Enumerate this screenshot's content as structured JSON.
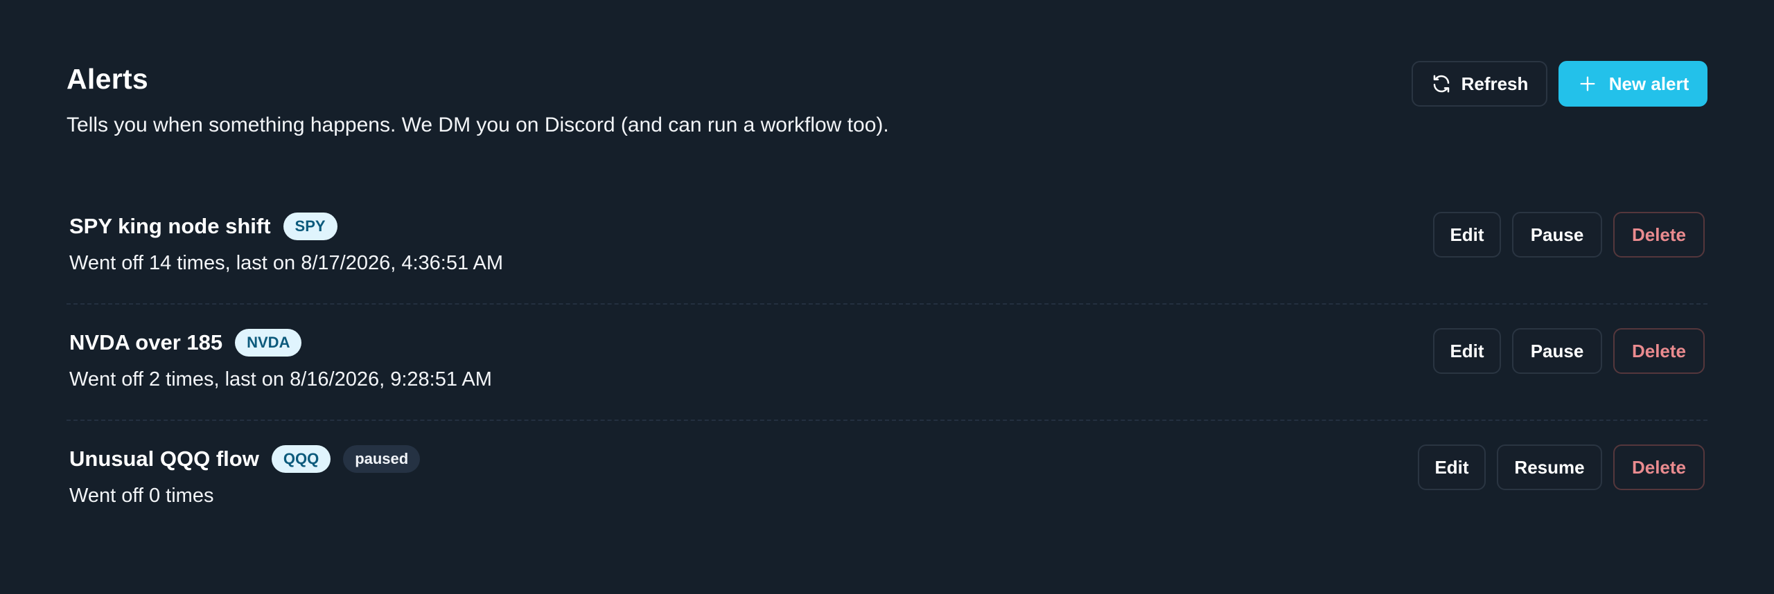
{
  "header": {
    "title": "Alerts",
    "subtitle": "Tells you when something happens. We DM you on Discord (and can run a workflow too).",
    "refresh_label": "Refresh",
    "new_alert_label": "New alert",
    "refresh_icon": "refresh-icon",
    "plus_icon": "plus-icon"
  },
  "alerts": [
    {
      "name": "SPY king node shift",
      "ticker": "SPY",
      "status": "",
      "meta": "Went off 14 times, last on 8/17/2026, 4:36:51 AM",
      "edit_label": "Edit",
      "toggle_label": "Pause",
      "delete_label": "Delete"
    },
    {
      "name": "NVDA over 185",
      "ticker": "NVDA",
      "status": "",
      "meta": "Went off 2 times, last on 8/16/2026, 9:28:51 AM",
      "edit_label": "Edit",
      "toggle_label": "Pause",
      "delete_label": "Delete"
    },
    {
      "name": "Unusual QQQ flow",
      "ticker": "QQQ",
      "status": "paused",
      "meta": "Went off 0 times",
      "edit_label": "Edit",
      "toggle_label": "Resume",
      "delete_label": "Delete"
    }
  ],
  "colors": {
    "background": "#151f2a",
    "accent": "#23c1ea",
    "danger": "#ea8b8f",
    "ticker_badge_bg": "#e0f4fd",
    "ticker_badge_text": "#0c5a7c"
  }
}
